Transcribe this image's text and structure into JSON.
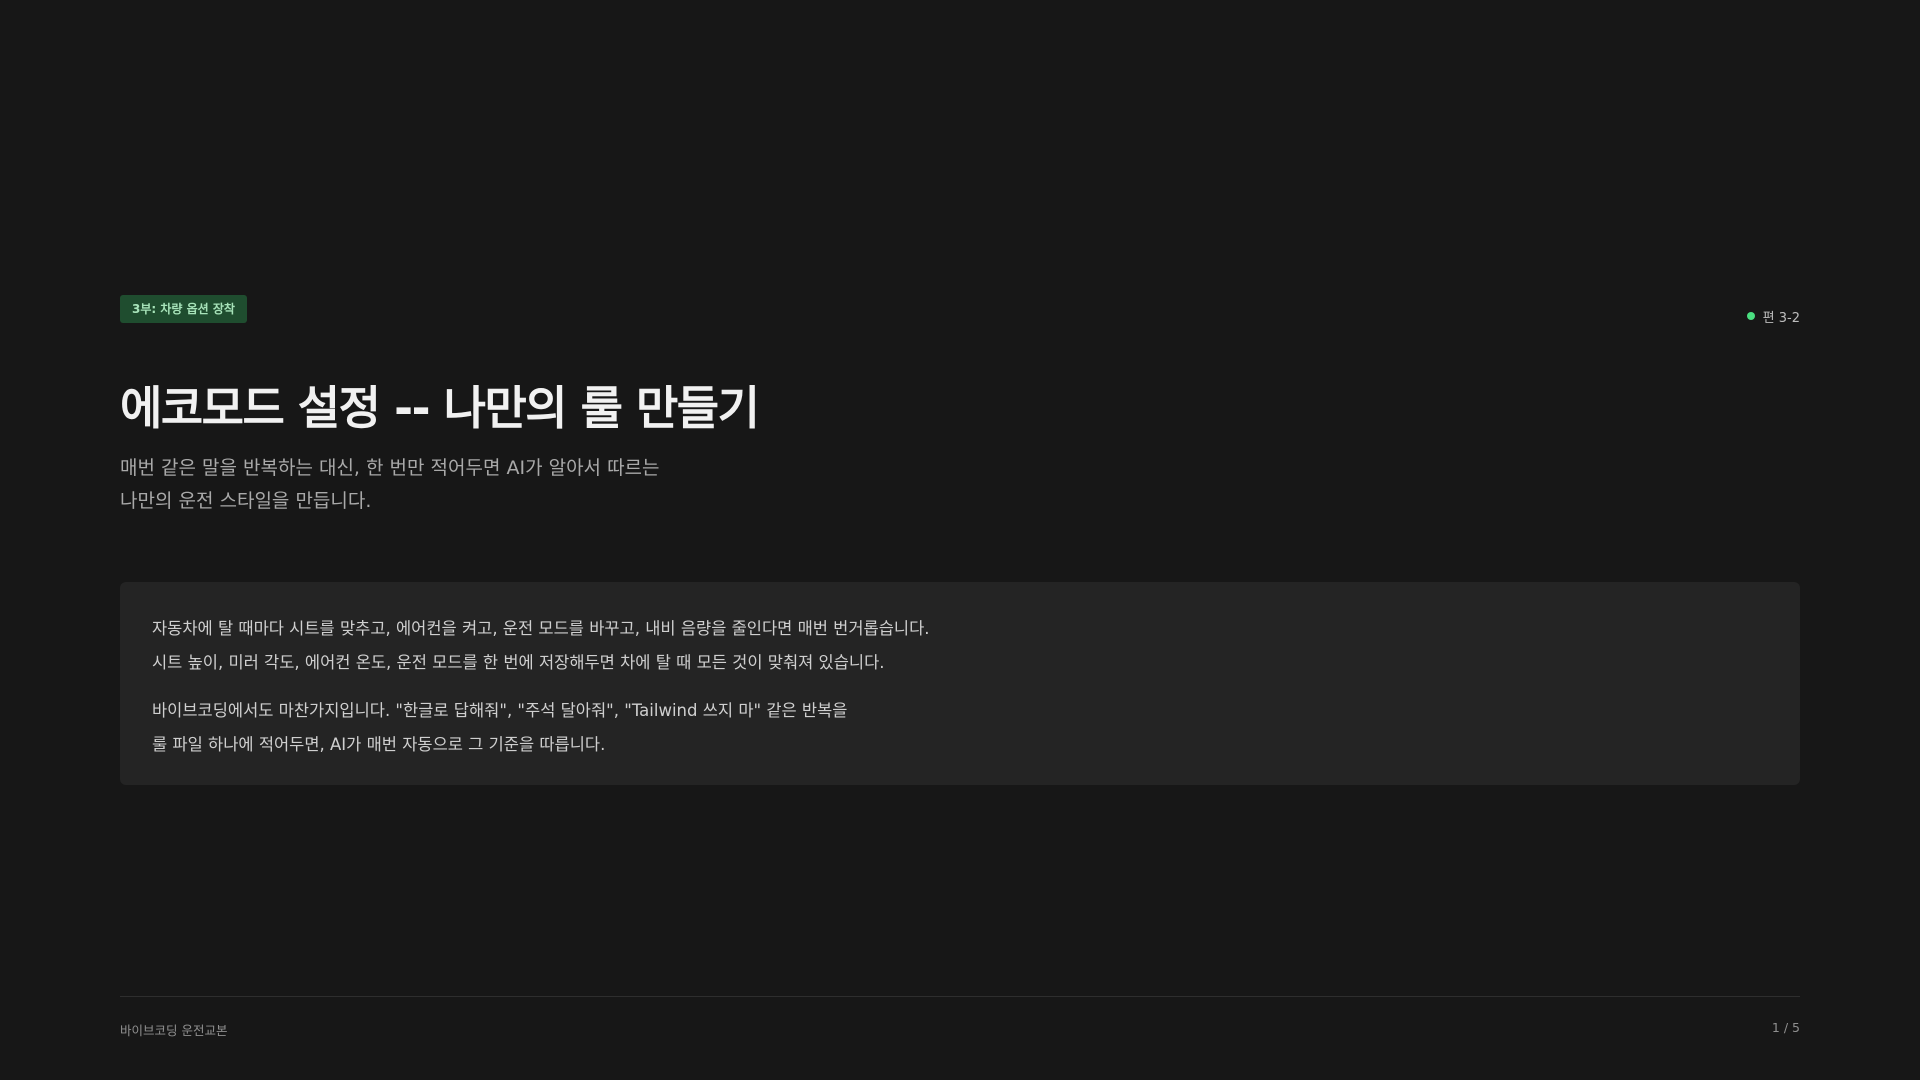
{
  "header": {
    "part_tag": "3부: 차량 옵션 장착",
    "episode": "편 3-2"
  },
  "main": {
    "title": "에코모드 설정 -- 나만의 룰 만들기",
    "subtitle_lines": [
      "매번 같은 말을 반복하는 대신, 한 번만 적어두면 AI가 알아서 따르는",
      "나만의 운전 스타일을 만듭니다."
    ],
    "card": {
      "paragraph1": [
        "자동차에 탈 때마다 시트를 맞추고, 에어컨을 켜고, 운전 모드를 바꾸고, 내비 음량을 줄인다면 매번 번거롭습니다.",
        "시트 높이, 미러 각도, 에어컨 온도, 운전 모드를 한 번에 저장해두면 차에 탈 때 모든 것이 맞춰져 있습니다."
      ],
      "paragraph2": [
        "바이브코딩에서도 마찬가지입니다. \"한글로 답해줘\", \"주석 달아줘\", \"Tailwind 쓰지 마\" 같은 반복을",
        "룰 파일 하나에 적어두면, AI가 매번 자동으로 그 기준을 따릅니다."
      ]
    }
  },
  "footer": {
    "book_title": "바이브코딩 운전교본",
    "page_indicator": "1 / 5"
  },
  "colors": {
    "background": "#171717",
    "card": "#242424",
    "tag_background": "#1f4d2f",
    "status_dot": "#4ade80"
  },
  "icons": {
    "status": "dot-icon"
  }
}
